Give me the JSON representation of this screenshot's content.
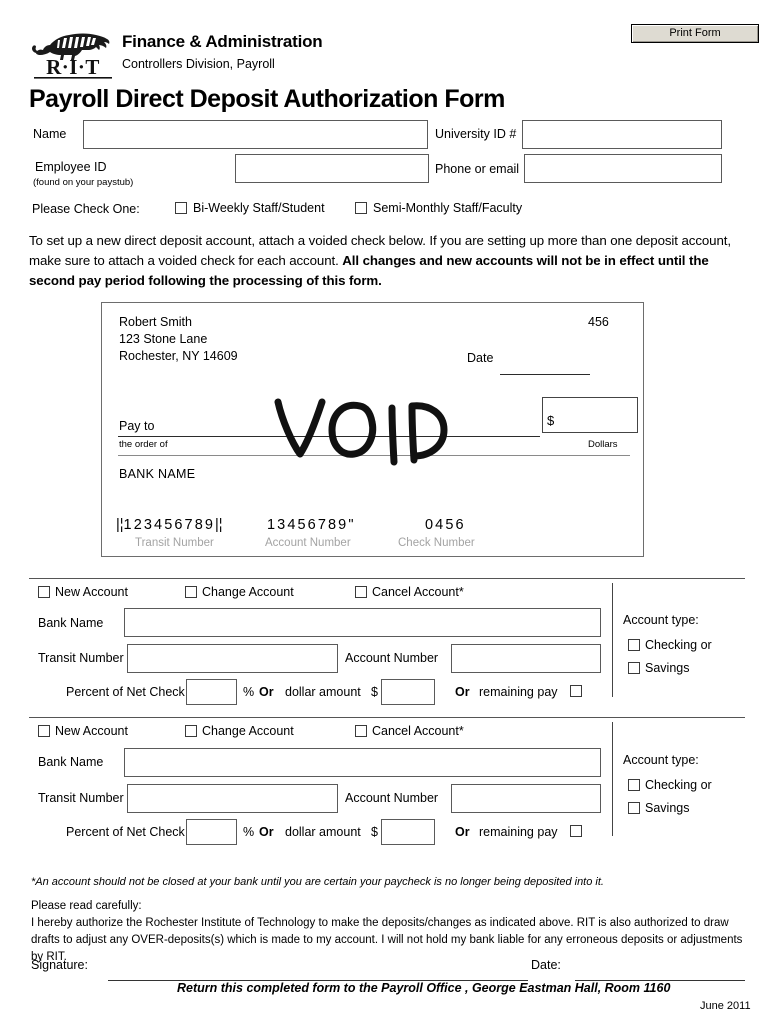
{
  "header": {
    "print_button": "Print Form",
    "department": "Finance & Administration",
    "division": "Controllers Division, Payroll",
    "logo_text": "R·I·T",
    "form_title": "Payroll Direct Deposit Authorization Form"
  },
  "identity": {
    "name_label": "Name",
    "name_value": "",
    "university_id_label": "University ID #",
    "university_id_value": "",
    "employee_id_label": "Employee ID",
    "employee_id_note": "(found on your paystub)",
    "employee_id_value": "",
    "phone_email_label": "Phone or email",
    "phone_email_value": "",
    "check_one_label": "Please Check One:",
    "pay_cycle_options": [
      {
        "label": "Bi-Weekly Staff/Student",
        "checked": false
      },
      {
        "label": "Semi-Monthly Staff/Faculty",
        "checked": false
      }
    ]
  },
  "instructions": {
    "normal_1": "To set up a new direct deposit account, attach a voided check below. If you are setting up more than one deposit account, make sure to attach a voided check for each account. ",
    "bold_1": "All changes and new accounts will not be in effect until the second pay period following the processing of this form."
  },
  "sample_check": {
    "payer_name": "Robert Smith",
    "payer_street": "123 Stone Lane",
    "payer_city": "Rochester, NY 14609",
    "check_no": "456",
    "date_label": "Date",
    "pay_to_label": "Pay to",
    "order_of_label": "the order of",
    "dollar_sign": "$",
    "dollars_label": "Dollars",
    "bank_name_label": "BANK NAME",
    "void_stamp": "VOID",
    "transit_number": "123456789",
    "transit_label": "Transit Number",
    "account_number": "13456789",
    "account_label": "Account Number",
    "check_number": "0456",
    "check_number_label": "Check Number"
  },
  "accounts": [
    {
      "actions": [
        {
          "label": "New Account",
          "checked": false
        },
        {
          "label": "Change Account",
          "checked": false
        },
        {
          "label": "Cancel Account*",
          "checked": false
        }
      ],
      "bank_name_label": "Bank Name",
      "bank_name_value": "",
      "transit_number_label": "Transit Number",
      "transit_number_value": "",
      "account_number_label": "Account Number",
      "account_number_value": "",
      "percent_label": "Percent of Net Check",
      "percent_value": "",
      "percent_sign": "%",
      "or_1": "Or",
      "dollar_label": "dollar amount",
      "dollar_sign": "$",
      "dollar_value": "",
      "or_2": "Or",
      "remaining_label": "remaining pay",
      "remaining_checked": false,
      "account_type_label": "Account type:",
      "types": [
        {
          "label": "Checking or",
          "checked": false
        },
        {
          "label": "Savings",
          "checked": false
        }
      ]
    },
    {
      "actions": [
        {
          "label": "New Account",
          "checked": false
        },
        {
          "label": "Change Account",
          "checked": false
        },
        {
          "label": "Cancel Account*",
          "checked": false
        }
      ],
      "bank_name_label": "Bank Name",
      "bank_name_value": "",
      "transit_number_label": "Transit Number",
      "transit_number_value": "",
      "account_number_label": "Account Number",
      "account_number_value": "",
      "percent_label": "Percent of Net Check",
      "percent_value": "",
      "percent_sign": "%",
      "or_1": "Or",
      "dollar_label": "dollar amount",
      "dollar_sign": "$",
      "dollar_value": "",
      "or_2": "Or",
      "remaining_label": "remaining pay",
      "remaining_checked": false,
      "account_type_label": "Account type:",
      "types": [
        {
          "label": "Checking or",
          "checked": false
        },
        {
          "label": "Savings",
          "checked": false
        }
      ]
    }
  ],
  "footer": {
    "asterisk_note": "*An account should not be closed at your bank until you are certain your paycheck is no longer being deposited into it.",
    "read_carefully": "Please read carefully:",
    "authorization": "I hereby authorize the Rochester Institute of Technology to make the deposits/changes as indicated above. RIT is also authorized to draw drafts to adjust any OVER-deposits(s) which is made to my account. I will not hold my bank liable for any erroneous deposits or adjustments by RIT.",
    "signature_label": "Signature:",
    "signature_value": "",
    "date_label": "Date:",
    "date_value": "",
    "return_note": "Return this completed form to the Payroll Office , George Eastman Hall, Room 1160",
    "revision_date": "June 2011"
  }
}
